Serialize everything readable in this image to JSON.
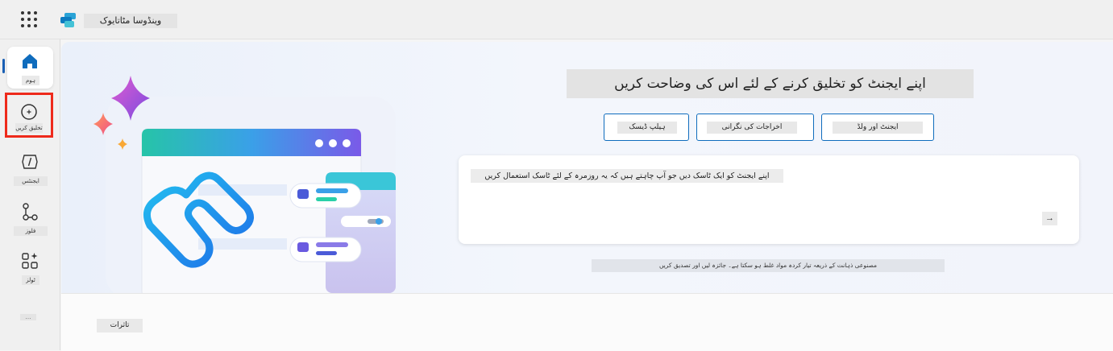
{
  "header": {
    "app_title": "وینڈوسا مٹاتایوک",
    "waffle_icon": "app-launcher-icon",
    "logo_icon": "copilot-studio-logo"
  },
  "nav": {
    "items": [
      {
        "label": "ہوم",
        "icon": "home-icon"
      },
      {
        "label": "تخلیق کریں",
        "icon": "plus-circle-icon"
      },
      {
        "label": "ایجنٹس",
        "icon": "agent-code-icon"
      },
      {
        "label": "فلوز",
        "icon": "flow-icon"
      },
      {
        "label": "ٹولز",
        "icon": "tools-icon"
      }
    ],
    "more_label": "…"
  },
  "hero": {
    "heading": "اپنے ایجنٹ کو تخلیق کرنے کے لئے اس کی وضاحت کریں",
    "buttons": [
      {
        "label": "ایجنٹ اور ولڈ"
      },
      {
        "label": "اخراجات کی نگرانی"
      },
      {
        "label": "ہیلپ ڈیسک"
      }
    ],
    "prompt_placeholder": "اپنے ایجنٹ کو ایک ٹاسک دیں جو آپ چاہتے ہیں کہ یہ روزمرہ کے لئے ٹاسک استعمال کریں",
    "send_label": "→",
    "disclaimer": "مصنوعی ذہانت کے ذریعہ تیار کردہ مواد غلط ہو سکتا ہے۔ جائزہ لیں اور تصدیق کریں"
  },
  "footer": {
    "feedback_label": "تاثرات"
  },
  "colors": {
    "accent": "#0f6cbd",
    "highlight_box": "#ee2a1b"
  }
}
